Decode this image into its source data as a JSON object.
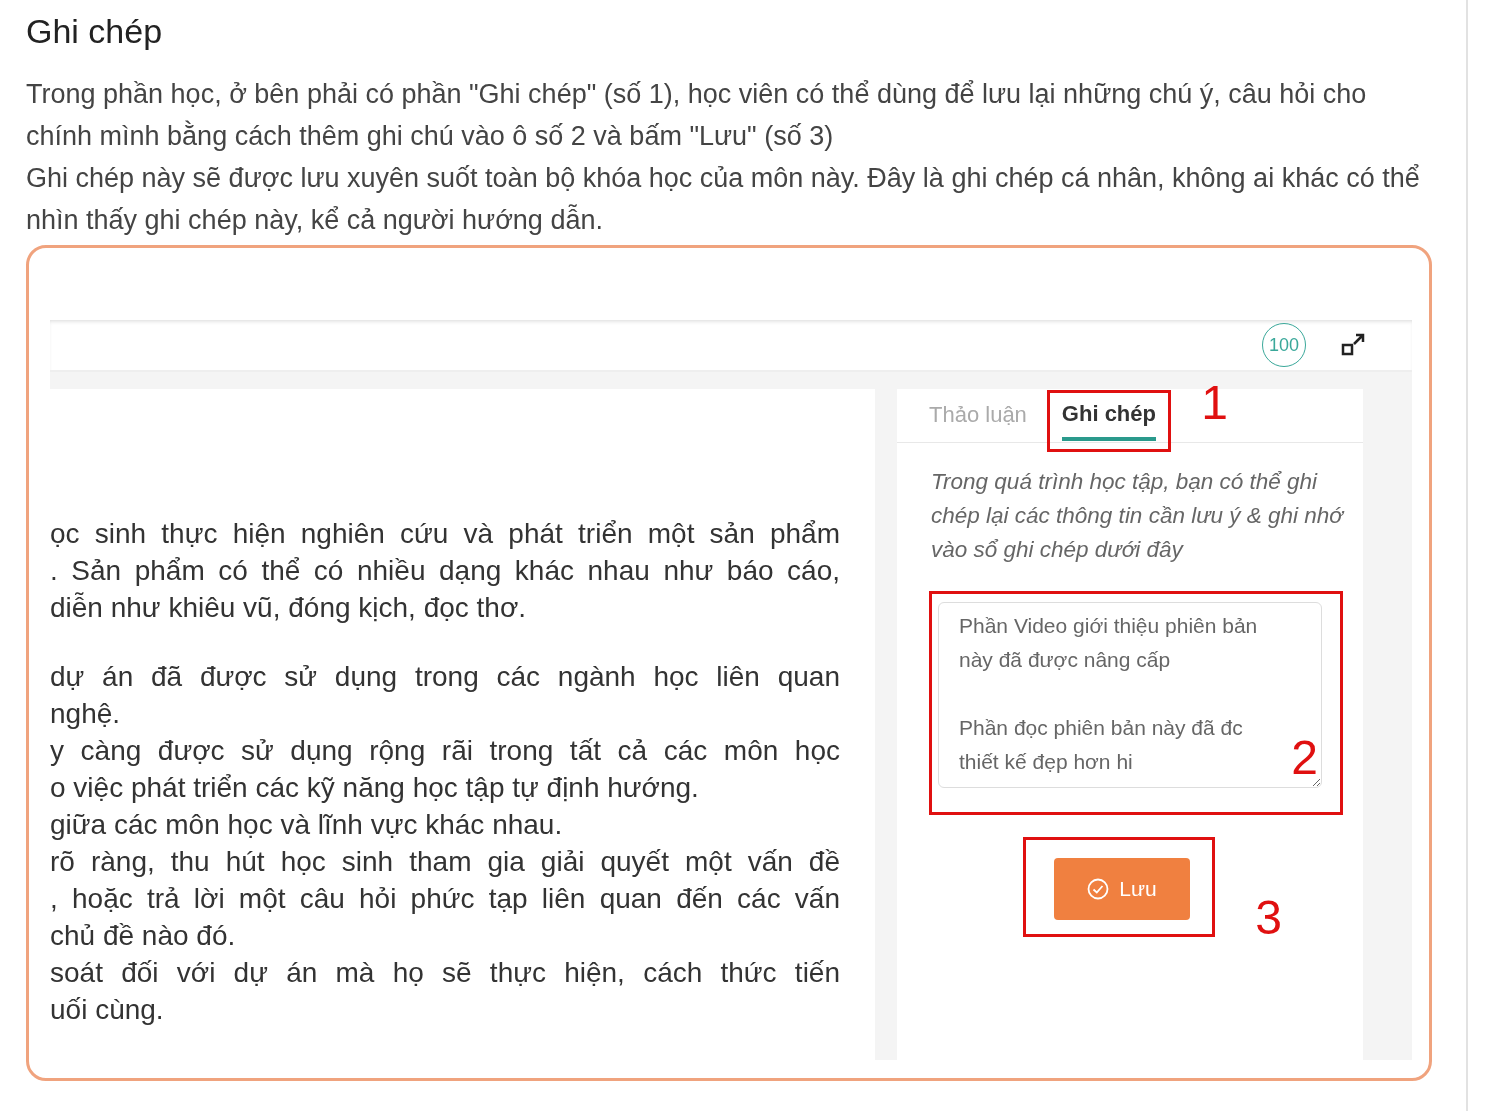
{
  "heading": "Ghi chép",
  "paragraphs": [
    "Trong phần học, ở bên phải có phần \"Ghi chép\" (số 1), học viên có thể dùng để lưu lại những chú ý, câu hỏi cho chính mình bằng cách thêm ghi chú vào ô số 2 và bấm \"Lưu\" (số 3)",
    "Ghi chép này sẽ được lưu xuyên suốt toàn bộ khóa học của môn này. Đây là ghi chép cá nhân, không ai khác có thể nhìn thấy ghi chép này, kể cả người hướng dẫn."
  ],
  "screenshot": {
    "top_bar": {
      "score": "100"
    },
    "lesson_text": [
      [
        {
          "text": "ọc sinh thực hiện nghiên cứu và phát triển một sản phẩm",
          "justified": true
        },
        {
          "text": ". Sản phẩm có thể có nhiều dạng khác nhau như báo cáo,",
          "justified": true
        },
        {
          "text": "diễn như khiêu vũ, đóng kịch, đọc thơ.",
          "justified": false
        }
      ],
      [
        {
          "text": "dự án đã được sử dụng trong các ngành học liên quan",
          "justified": true
        },
        {
          "text": "nghệ.",
          "justified": false
        },
        {
          "text": "y càng được sử dụng rộng rãi trong tất cả các môn học",
          "justified": true
        },
        {
          "text": "o việc phát triển các kỹ năng học tập tự định hướng.",
          "justified": false
        },
        {
          "text": "giữa các môn học và lĩnh vực khác nhau.",
          "justified": false
        },
        {
          "text": "rõ ràng, thu hút học sinh tham gia giải quyết một vấn đề",
          "justified": true
        },
        {
          "text": ", hoặc trả lời một câu hỏi phức tạp liên quan đến các vấn",
          "justified": true
        },
        {
          "text": "chủ đề nào đó.",
          "justified": false
        },
        {
          "text": "soát đối với dự án mà họ sẽ thực hiện, cách thức tiến",
          "justified": true
        },
        {
          "text": "uối cùng.",
          "justified": false
        }
      ]
    ],
    "notes_panel": {
      "tabs": [
        {
          "label": "Thảo luận",
          "selected": false
        },
        {
          "label": "Ghi chép",
          "selected": true,
          "callout": "1"
        }
      ],
      "description": "Trong quá trình học tập, bạn có thể ghi chép lại các thông tin cần lưu ý & ghi nhớ vào sổ ghi chép dưới đây",
      "note": {
        "value": "Phần Video giới thiệu phiên bản này đã được nâng cấp\n\nPhần đọc phiên bản này đã đc thiết kế đẹp hơn hi",
        "callout": "2"
      },
      "save_button": {
        "label": "Lưu",
        "callout": "3"
      }
    }
  }
}
